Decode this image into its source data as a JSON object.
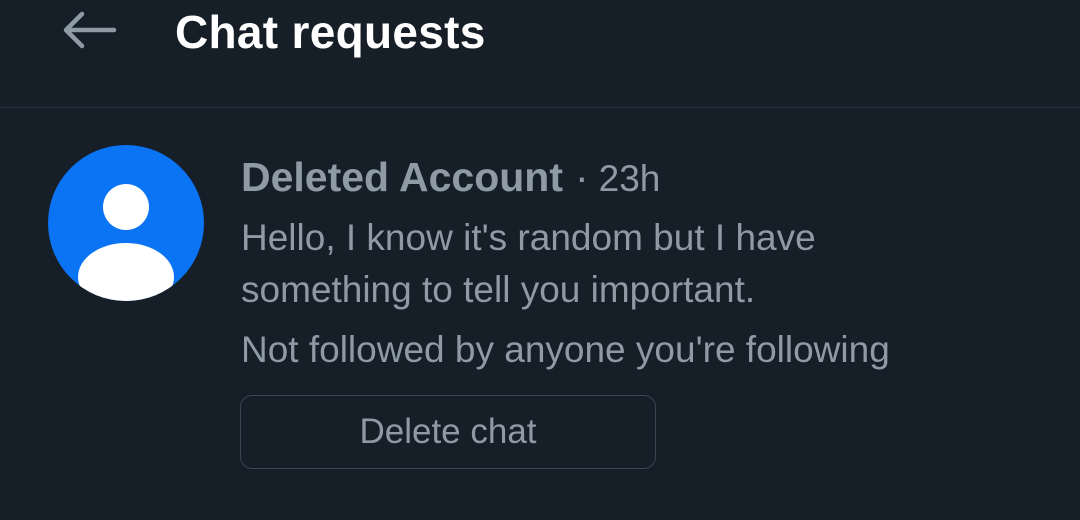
{
  "header": {
    "back_icon": "arrow-left-icon",
    "title": "Chat requests"
  },
  "request": {
    "avatar_icon": "default-user-icon",
    "sender_name": "Deleted Account",
    "separator": "·",
    "time": "23h",
    "message": "Hello, I know it's random but I have something to tell you important.",
    "context": "Not followed by anyone you're following",
    "delete_label": "Delete chat"
  },
  "colors": {
    "background": "#161e27",
    "avatar_blue": "#0a74f5",
    "muted_text": "#8f9aa7",
    "title_text": "#ffffff"
  }
}
